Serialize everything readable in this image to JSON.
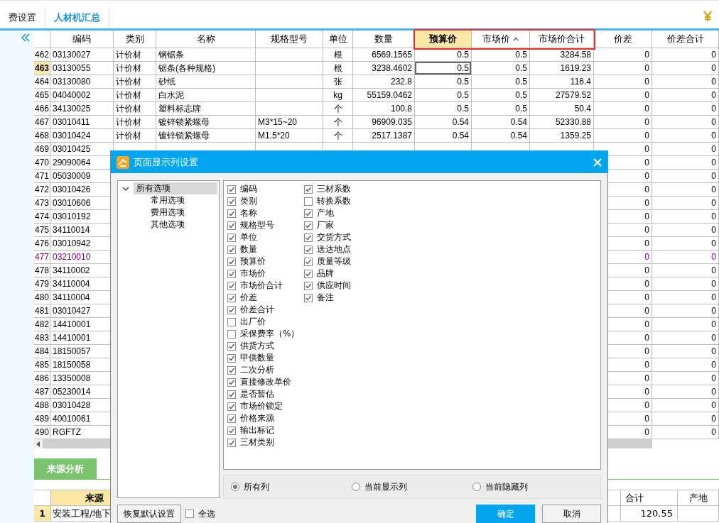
{
  "tabs": [
    {
      "label": "费设置",
      "selected": false
    },
    {
      "label": "人材机汇总",
      "selected": true
    }
  ],
  "table": {
    "columns": [
      {
        "label": "编码",
        "selected": false,
        "sorted": false,
        "outlined": false
      },
      {
        "label": "类别",
        "selected": false,
        "sorted": false,
        "outlined": false
      },
      {
        "label": "名称",
        "selected": false,
        "sorted": false,
        "outlined": false
      },
      {
        "label": "规格型号",
        "selected": false,
        "sorted": false,
        "outlined": false
      },
      {
        "label": "单位",
        "selected": false,
        "sorted": false,
        "outlined": false
      },
      {
        "label": "数量",
        "selected": false,
        "sorted": false,
        "outlined": false
      },
      {
        "label": "预算价",
        "selected": true,
        "sorted": false,
        "outlined": true
      },
      {
        "label": "市场价",
        "selected": false,
        "sorted": true,
        "outlined": true
      },
      {
        "label": "市场价合计",
        "selected": false,
        "sorted": false,
        "outlined": true
      },
      {
        "label": "价差",
        "selected": false,
        "sorted": false,
        "outlined": false
      },
      {
        "label": "价差合计",
        "selected": false,
        "sorted": false,
        "outlined": false
      }
    ],
    "rows": [
      {
        "number": "462",
        "selected": false,
        "color": "#000000",
        "cells": [
          "03130027",
          "计价材",
          "钢锯条",
          "",
          "根",
          "6569.1565",
          "0.5",
          "0.5",
          "3284.58",
          "0",
          "0"
        ]
      },
      {
        "number": "463",
        "selected": true,
        "color": "#000000",
        "cells": [
          "03130055",
          "计价材",
          "锯条(各种规格)",
          "",
          "根",
          "3238.4602",
          "0.5",
          "0.5",
          "1619.23",
          "0",
          "0"
        ]
      },
      {
        "number": "464",
        "selected": false,
        "color": "#000000",
        "cells": [
          "03130080",
          "计价材",
          "砂纸",
          "",
          "张",
          "232.8",
          "0.5",
          "0.5",
          "116.4",
          "0",
          "0"
        ]
      },
      {
        "number": "465",
        "selected": false,
        "color": "#000000",
        "cells": [
          "04040002",
          "计价材",
          "白水泥",
          "",
          "kg",
          "55159.0462",
          "0.5",
          "0.5",
          "27579.52",
          "0",
          "0"
        ]
      },
      {
        "number": "466",
        "selected": false,
        "color": "#000000",
        "cells": [
          "34130025",
          "计价材",
          "塑料标志牌",
          "",
          "个",
          "100.8",
          "0.5",
          "0.5",
          "50.4",
          "0",
          "0"
        ]
      },
      {
        "number": "467",
        "selected": false,
        "color": "#000000",
        "cells": [
          "03010411",
          "计价材",
          "镀锌锁紧螺母",
          "M3*15~20",
          "个",
          "96909.035",
          "0.54",
          "0.54",
          "52330.88",
          "0",
          "0"
        ]
      },
      {
        "number": "468",
        "selected": false,
        "color": "#000000",
        "cells": [
          "03010424",
          "计价材",
          "镀锌锁紧螺母",
          "M1.5*20",
          "个",
          "2517.1387",
          "0.54",
          "0.54",
          "1359.25",
          "0",
          "0"
        ]
      },
      {
        "number": "469",
        "selected": false,
        "color": "#000000",
        "cells": [
          "03010425",
          "",
          "",
          "",
          "",
          "",
          "",
          "",
          "",
          "0",
          "0"
        ]
      },
      {
        "number": "470",
        "selected": false,
        "color": "#000000",
        "cells": [
          "29090064",
          "",
          "",
          "",
          "",
          "",
          "",
          "",
          "",
          "0",
          "0"
        ]
      },
      {
        "number": "471",
        "selected": false,
        "color": "#000000",
        "cells": [
          "05030009",
          "",
          "",
          "",
          "",
          "",
          "",
          "",
          "",
          "0",
          "0"
        ]
      },
      {
        "number": "472",
        "selected": false,
        "color": "#000000",
        "cells": [
          "03010426",
          "",
          "",
          "",
          "",
          "",
          "",
          "",
          "",
          "0",
          "0"
        ]
      },
      {
        "number": "473",
        "selected": false,
        "color": "#000000",
        "cells": [
          "03010606",
          "",
          "",
          "",
          "",
          "",
          "",
          "",
          "",
          "0",
          "0"
        ]
      },
      {
        "number": "474",
        "selected": false,
        "color": "#000000",
        "cells": [
          "03010192",
          "",
          "",
          "",
          "",
          "",
          "",
          "",
          "",
          "0",
          "0"
        ]
      },
      {
        "number": "475",
        "selected": false,
        "color": "#000000",
        "cells": [
          "34110014",
          "",
          "",
          "",
          "",
          "",
          "",
          "",
          "",
          "0",
          "0"
        ]
      },
      {
        "number": "476",
        "selected": false,
        "color": "#000000",
        "cells": [
          "03010942",
          "",
          "",
          "",
          "",
          "",
          "",
          "",
          "",
          "0",
          "0"
        ]
      },
      {
        "number": "477",
        "selected": false,
        "color": "#800080",
        "cells": [
          "03210010",
          "",
          "",
          "",
          "",
          "",
          "",
          "",
          "",
          "0",
          "0"
        ]
      },
      {
        "number": "478",
        "selected": false,
        "color": "#000000",
        "cells": [
          "34110002",
          "",
          "",
          "",
          "",
          "",
          "",
          "",
          "",
          "0",
          "0"
        ]
      },
      {
        "number": "479",
        "selected": false,
        "color": "#000000",
        "cells": [
          "34110004",
          "",
          "",
          "",
          "",
          "",
          "",
          "",
          "",
          "0",
          "0"
        ]
      },
      {
        "number": "480",
        "selected": false,
        "color": "#000000",
        "cells": [
          "34110004",
          "",
          "",
          "",
          "",
          "",
          "",
          "",
          "",
          "0",
          "0"
        ]
      },
      {
        "number": "481",
        "selected": false,
        "color": "#000000",
        "cells": [
          "03010427",
          "",
          "",
          "",
          "",
          "",
          "",
          "",
          "",
          "0",
          "0"
        ]
      },
      {
        "number": "482",
        "selected": false,
        "color": "#000000",
        "cells": [
          "14410001",
          "",
          "",
          "",
          "",
          "",
          "",
          "",
          "",
          "0",
          "0"
        ]
      },
      {
        "number": "483",
        "selected": false,
        "color": "#000000",
        "cells": [
          "14410001",
          "",
          "",
          "",
          "",
          "",
          "",
          "",
          "",
          "0",
          "0"
        ]
      },
      {
        "number": "484",
        "selected": false,
        "color": "#000000",
        "cells": [
          "18150057",
          "",
          "",
          "",
          "",
          "",
          "",
          "",
          "",
          "0",
          "0"
        ]
      },
      {
        "number": "485",
        "selected": false,
        "color": "#000000",
        "cells": [
          "18150058",
          "",
          "",
          "",
          "",
          "",
          "",
          "",
          "",
          "0",
          "0"
        ]
      },
      {
        "number": "486",
        "selected": false,
        "color": "#000000",
        "cells": [
          "13350008",
          "",
          "",
          "",
          "",
          "",
          "",
          "",
          "",
          "0",
          "0"
        ]
      },
      {
        "number": "487",
        "selected": false,
        "color": "#000000",
        "cells": [
          "05230014",
          "",
          "",
          "",
          "",
          "",
          "",
          "",
          "",
          "0",
          "0"
        ]
      },
      {
        "number": "488",
        "selected": false,
        "color": "#000000",
        "cells": [
          "03010428",
          "",
          "",
          "",
          "",
          "",
          "",
          "",
          "",
          "0",
          "0"
        ]
      },
      {
        "number": "489",
        "selected": false,
        "color": "#000000",
        "cells": [
          "40010061",
          "",
          "",
          "",
          "",
          "",
          "",
          "",
          "",
          "0",
          "0"
        ]
      },
      {
        "number": "490",
        "selected": false,
        "color": "#000000",
        "cells": [
          "RGFTZ",
          "",
          "",
          "",
          "",
          "",
          "",
          "",
          "",
          "0",
          "0"
        ]
      }
    ]
  },
  "bottom_panel": {
    "tabs": [
      {
        "label": "来源分析",
        "selected": true
      }
    ],
    "table": {
      "columns": [
        "来源",
        "合计",
        "产地"
      ],
      "rows": [
        {
          "number": "1",
          "selected": true,
          "cells": [
            "安装工程/地下",
            "120.55"
          ]
        }
      ]
    }
  },
  "dialog": {
    "title": "页面显示列设置",
    "tree": [
      {
        "label": "所有选项",
        "expanded": true,
        "selected": true,
        "children": [
          {
            "label": "常用选项",
            "selected": false
          },
          {
            "label": "费用选项",
            "selected": false
          },
          {
            "label": "其他选项",
            "selected": false
          }
        ]
      }
    ],
    "columns": [
      [
        {
          "label": "编码",
          "checked": true
        },
        {
          "label": "类别",
          "checked": true
        },
        {
          "label": "名称",
          "checked": true
        },
        {
          "label": "规格型号",
          "checked": true
        },
        {
          "label": "单位",
          "checked": true
        },
        {
          "label": "数量",
          "checked": true
        },
        {
          "label": "预算价",
          "checked": true
        },
        {
          "label": "市场价",
          "checked": true
        },
        {
          "label": "市场价合计",
          "checked": true
        },
        {
          "label": "价差",
          "checked": true
        },
        {
          "label": "价差合计",
          "checked": true
        },
        {
          "label": "出厂价",
          "checked": false
        },
        {
          "label": "采保费率（%）",
          "checked": false
        },
        {
          "label": "供货方式",
          "checked": true
        },
        {
          "label": "甲供数量",
          "checked": true
        },
        {
          "label": "二次分析",
          "checked": true
        },
        {
          "label": "直接修改单价",
          "checked": true
        },
        {
          "label": "是否暂估",
          "checked": true
        },
        {
          "label": "市场价锁定",
          "checked": true
        },
        {
          "label": "价格来源",
          "checked": true
        },
        {
          "label": "输出标记",
          "checked": true
        },
        {
          "label": "三材类别",
          "checked": true
        }
      ],
      [
        {
          "label": "三材系数",
          "checked": true
        },
        {
          "label": "转换系数",
          "checked": false
        },
        {
          "label": "产地",
          "checked": true
        },
        {
          "label": "厂家",
          "checked": true
        },
        {
          "label": "交货方式",
          "checked": true
        },
        {
          "label": "送达地点",
          "checked": true
        },
        {
          "label": "质量等级",
          "checked": true
        },
        {
          "label": "品牌",
          "checked": true
        },
        {
          "label": "供应时间",
          "checked": true
        },
        {
          "label": "备注",
          "checked": true
        }
      ]
    ],
    "radios": [
      {
        "label": "所有列",
        "selected": true
      },
      {
        "label": "当前显示列",
        "selected": false
      },
      {
        "label": "当前隐藏列",
        "selected": false
      }
    ],
    "restore_button": "恢复默认设置",
    "select_all": {
      "label": "全选",
      "checked": false
    },
    "buttons": [
      {
        "label": "确定",
        "kind": "primary"
      },
      {
        "label": "取消",
        "kind": "normal"
      }
    ]
  }
}
